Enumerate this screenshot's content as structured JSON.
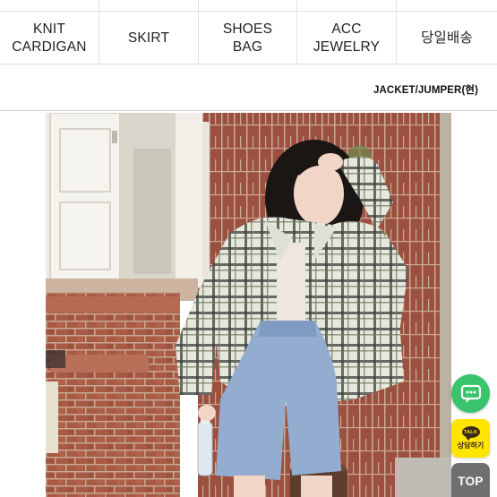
{
  "nav": {
    "cells": [
      {
        "line1": "KNIT",
        "line2": "CARDIGAN"
      },
      {
        "line1": "SKIRT",
        "line2": ""
      },
      {
        "line1": "SHOES",
        "line2": "BAG"
      },
      {
        "line1": "ACC",
        "line2": "JEWELRY"
      },
      {
        "line1": "당일배송",
        "line2": ""
      }
    ]
  },
  "category": {
    "label": "JACKET/JUMPER(현)"
  },
  "product_image": {
    "icon": "product-photo"
  },
  "floating": {
    "chat_icon": "chat-bubble-icon",
    "talk_badge": "TALK",
    "talk_label": "상담하기",
    "top_label": "TOP"
  },
  "colors": {
    "chat": "#37c46b",
    "kakao": "#ffe500",
    "top": "#6f6f6f"
  }
}
